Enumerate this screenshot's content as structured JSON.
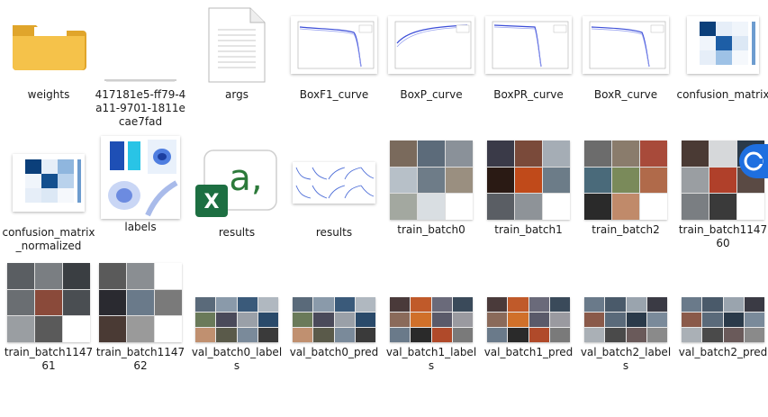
{
  "files": [
    {
      "name": "weights",
      "kind": "folder"
    },
    {
      "name": "417181e5-ff79-4a11-9701-1811ecae7fad",
      "kind": "text"
    },
    {
      "name": "args",
      "kind": "document"
    },
    {
      "name": "BoxF1_curve",
      "kind": "curve-image"
    },
    {
      "name": "BoxP_curve",
      "kind": "curve-image"
    },
    {
      "name": "BoxPR_curve",
      "kind": "curve-image"
    },
    {
      "name": "BoxR_curve",
      "kind": "curve-image"
    },
    {
      "name": "confusion_matrix",
      "kind": "matrix-image"
    },
    {
      "name": "confusion_matrix_normalized",
      "kind": "matrix-image"
    },
    {
      "name": "labels",
      "kind": "labels-image"
    },
    {
      "name": "results",
      "kind": "excel"
    },
    {
      "name": "results",
      "kind": "results-image"
    },
    {
      "name": "train_batch0",
      "kind": "batch-image"
    },
    {
      "name": "train_batch1",
      "kind": "batch-image"
    },
    {
      "name": "train_batch2",
      "kind": "batch-image"
    },
    {
      "name": "train_batch114760",
      "kind": "batch-image"
    },
    {
      "name": "train_batch114761",
      "kind": "batch-image"
    },
    {
      "name": "train_batch114762",
      "kind": "batch-image"
    },
    {
      "name": "val_batch0_labels",
      "kind": "val-image"
    },
    {
      "name": "val_batch0_pred",
      "kind": "val-image"
    },
    {
      "name": "val_batch1_labels",
      "kind": "val-image"
    },
    {
      "name": "val_batch1_pred",
      "kind": "val-image"
    },
    {
      "name": "val_batch2_labels",
      "kind": "val-image"
    },
    {
      "name": "val_batch2_pred",
      "kind": "val-image"
    }
  ],
  "colors": {
    "folder": "#f5c24a",
    "folder_dark": "#e0a52b",
    "excel": "#1d6f42",
    "excel_text": "#2c7a3a",
    "accent_blue": "#1e6fe0",
    "matrix_dark": "#0b3f7a"
  },
  "icons": {
    "folder": "folder-icon",
    "excel": "excel-icon",
    "document": "document-icon",
    "edge": "edge-assistant-icon"
  }
}
